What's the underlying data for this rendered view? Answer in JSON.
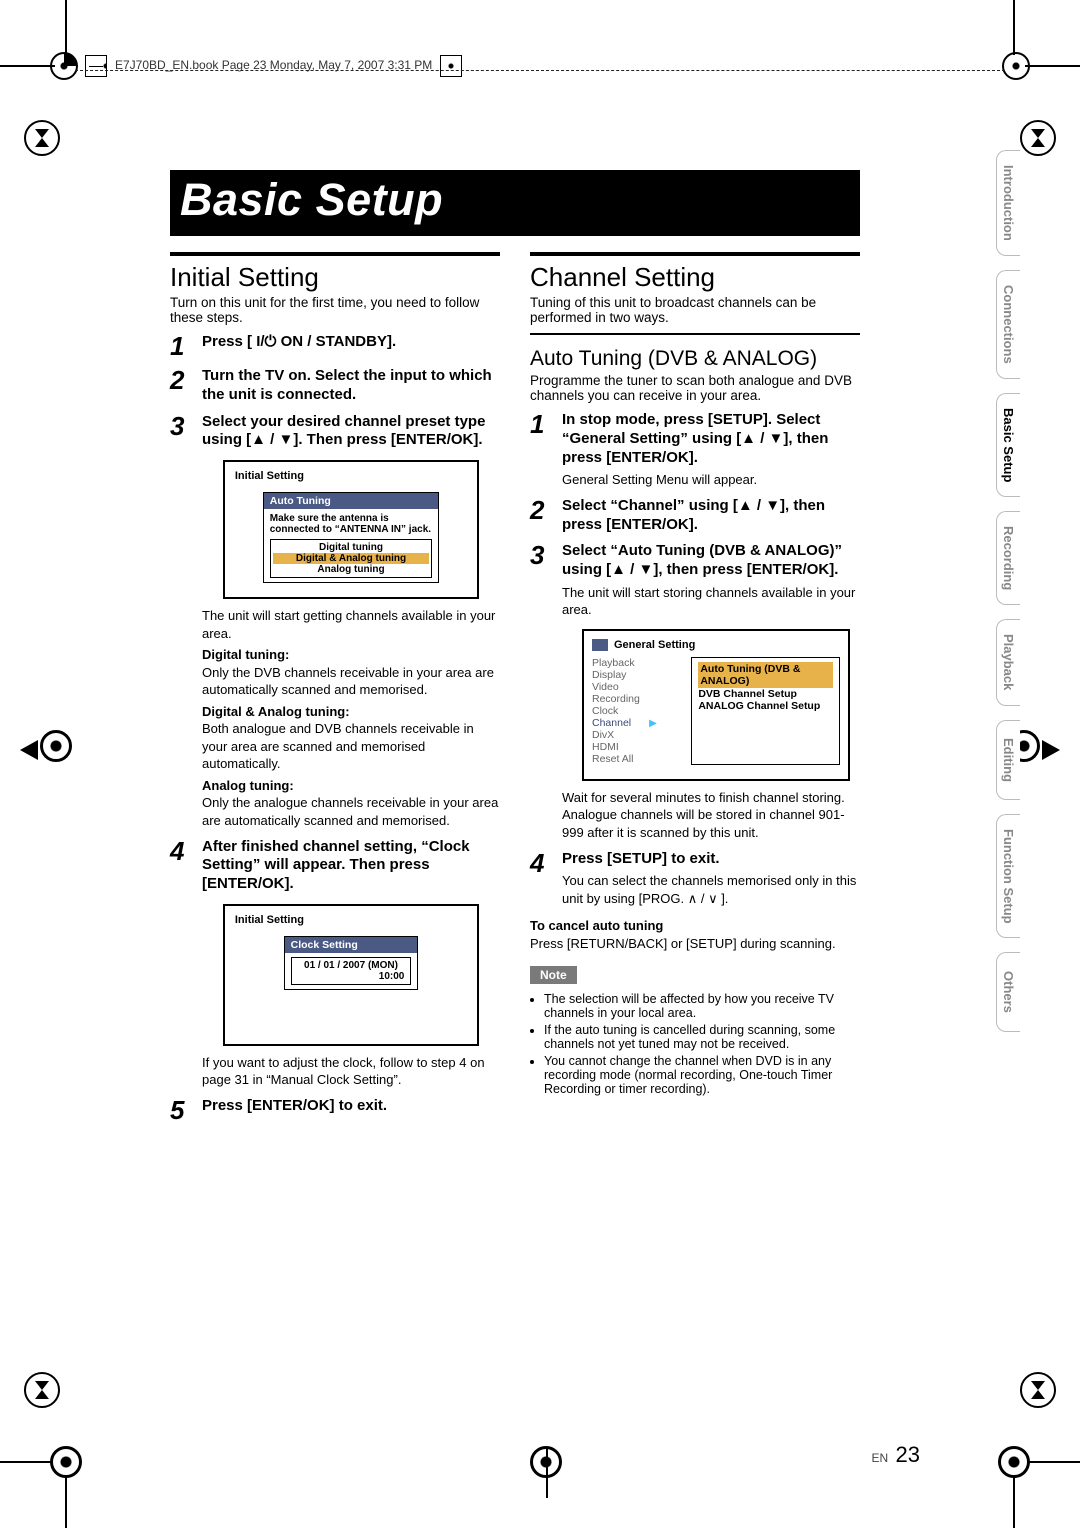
{
  "header": {
    "bookline": "E7J70BD_EN.book  Page 23  Monday, May 7, 2007  3:31 PM"
  },
  "title": "Basic Setup",
  "tabs": [
    "Introduction",
    "Connections",
    "Basic Setup",
    "Recording",
    "Playback",
    "Editing",
    "Function Setup",
    "Others"
  ],
  "active_tab_index": 2,
  "left": {
    "section": "Initial Setting",
    "lead": "Turn on this unit for the first time, you need to follow these steps.",
    "steps": [
      {
        "n": "1",
        "title": "Press [ I/⏻ ON / STANDBY]."
      },
      {
        "n": "2",
        "title": "Turn the TV on. Select the input to which the unit is connected."
      },
      {
        "n": "3",
        "title": "Select your desired channel preset type using [▲ / ▼]. Then press [ENTER/OK]."
      },
      {
        "n": "4",
        "title": "After finished channel setting, “Clock Setting” will appear. Then press [ENTER/OK]."
      },
      {
        "n": "5",
        "title": "Press [ENTER/OK] to exit."
      }
    ],
    "after_step3": {
      "osd_title": "Initial Setting",
      "inner_title": "Auto Tuning",
      "inner_lines": [
        "Make sure the antenna is",
        "connected to “ANTENNA IN” jack."
      ],
      "radio": [
        "Digital tuning",
        "Digital & Analog tuning",
        "Analog tuning"
      ],
      "radio_selected_index": 1,
      "tail_line": "The unit will start getting channels available in your area.",
      "subheads": [
        "Digital tuning:",
        "Digital & Analog tuning:",
        "Analog tuning:"
      ],
      "subtexts": [
        "Only the DVB channels receivable in your area are automatically scanned and memorised.",
        "Both analogue and DVB channels receivable in your area are scanned and memorised automatically.",
        "Only the analogue channels receivable in your area are automatically scanned and memorised."
      ]
    },
    "after_step4": {
      "osd_title": "Initial Setting",
      "inner_title": "Clock Setting",
      "clock_line1": "01 / 01 / 2007 (MON)",
      "clock_line2": "10:00",
      "tail_line": "If you want to adjust the clock, follow to step 4 on page 31 in “Manual Clock Setting”."
    }
  },
  "right": {
    "section": "Channel Setting",
    "lead": "Tuning of this unit to broadcast channels can be performed in two ways.",
    "sub": "Auto Tuning (DVB & ANALOG)",
    "sub_lead": "Programme the tuner to scan both analogue and DVB channels you can receive in your area.",
    "steps": [
      {
        "n": "1",
        "title": "In stop mode, press [SETUP]. Select “General Setting” using [▲ / ▼], then press [ENTER/OK].",
        "text": "General Setting Menu will appear."
      },
      {
        "n": "2",
        "title": "Select “Channel” using [▲ / ▼], then press [ENTER/OK]."
      },
      {
        "n": "3",
        "title": "Select “Auto Tuning (DVB & ANALOG)” using [▲ / ▼], then press [ENTER/OK].",
        "text": "The unit will start storing channels available in your area."
      },
      {
        "n": "4",
        "title": "Press [SETUP] to exit.",
        "text": "You can select the channels memorised only in this unit by using [PROG. ∧ / ∨ ]."
      }
    ],
    "osd": {
      "title": "General Setting",
      "menu": [
        "Playback",
        "Display",
        "Video",
        "Recording",
        "Clock",
        "Channel",
        "DivX",
        "HDMI",
        "Reset All"
      ],
      "menu_selected_index": 5,
      "panel": [
        "Auto Tuning (DVB & ANALOG)",
        "DVB Channel Setup",
        "ANALOG Channel Setup"
      ],
      "panel_selected_index": 0
    },
    "wait_lines": [
      "Wait for several minutes to finish channel storing.",
      "Analogue channels will be stored in channel 901-999 after it is scanned by this unit."
    ],
    "cancel_head": "To cancel auto tuning",
    "cancel_text": "Press [RETURN/BACK] or [SETUP] during scanning.",
    "note_label": "Note",
    "notes": [
      "The selection will be affected by how you receive TV channels in your local area.",
      "If the auto tuning is cancelled during scanning, some channels not yet tuned may not be received.",
      "You cannot change the channel when DVD is in any recording mode (normal recording, One-touch Timer Recording or timer recording)."
    ]
  },
  "footer": {
    "lang": "EN",
    "page": "23"
  }
}
